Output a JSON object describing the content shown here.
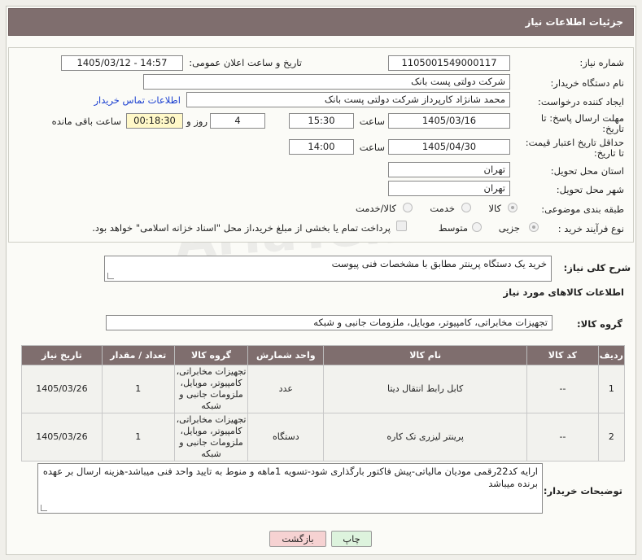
{
  "header": {
    "title": "جزئیات اطلاعات نیاز"
  },
  "form": {
    "need_number": {
      "label": "شماره نیاز:",
      "value": "1105001549000117"
    },
    "announce_datetime": {
      "label": "تاریخ و ساعت اعلان عمومی:",
      "value": "1405/03/12 - 14:57"
    },
    "buyer_org": {
      "label": "نام دستگاه خریدار:",
      "value": "شرکت دولتی پست بانک"
    },
    "requester": {
      "label": "ایجاد کننده درخواست:",
      "value": "محمد شانژاد کارپرداز شرکت دولتی پست بانک",
      "contact_link": "اطلاعات تماس خریدار"
    },
    "reply_deadline": {
      "label_line1": "مهلت ارسال پاسخ: تا",
      "label_line2": "تاریخ:",
      "date": "1405/03/16",
      "time_label": "ساعت",
      "time": "15:30",
      "days": "4",
      "days_label": "روز و",
      "remaining": "00:18:30",
      "remaining_label": "ساعت باقی مانده"
    },
    "price_validity": {
      "label_line1": "حداقل تاریخ اعتبار قیمت:",
      "label_line2": "تا تاریخ:",
      "date": "1405/04/30",
      "time_label": "ساعت",
      "time": "14:00"
    },
    "province": {
      "label": "استان محل تحویل:",
      "value": "تهران"
    },
    "city": {
      "label": "شهر محل تحویل:",
      "value": "تهران"
    },
    "category": {
      "label": "طبقه بندی موضوعی:",
      "options": [
        "کالا",
        "خدمت",
        "کالا/خدمت"
      ],
      "selected": "کالا"
    },
    "purchase_type": {
      "label": "نوع فرآیند خرید :",
      "options": [
        "جزیی",
        "متوسط"
      ],
      "selected": "جزیی",
      "payment_note": "پرداخت تمام یا بخشی از مبلغ خرید،از محل \"اسناد خزانه اسلامی\" خواهد بود."
    }
  },
  "summary": {
    "label": "شرح کلی نیاز:",
    "value": "خرید یک دستگاه پرینتر مطابق با مشخصات فنی پیوست"
  },
  "goods_section": {
    "title": "اطلاعات کالاهای مورد نیاز"
  },
  "goods_group": {
    "label": "گروه کالا:",
    "value": "تجهیزات مخابراتی، کامپیوتر، موبایل، ملزومات جانبی و شبکه"
  },
  "table": {
    "headers": [
      "ردیف",
      "کد کالا",
      "نام کالا",
      "واحد شمارش",
      "گروه کالا",
      "تعداد / مقدار",
      "تاریخ نیاز"
    ],
    "rows": [
      {
        "row": "1",
        "code": "--",
        "name": "کابل رابط انتقال دیتا",
        "unit": "عدد",
        "group": "تجهیزات مخابراتی، کامپیوتر، موبایل، ملزومات جانبی و شبکه",
        "qty": "1",
        "date": "1405/03/26"
      },
      {
        "row": "2",
        "code": "--",
        "name": "پرینتر لیزری تک کاره",
        "unit": "دستگاه",
        "group": "تجهیزات مخابراتی، کامپیوتر، موبایل، ملزومات جانبی و شبکه",
        "qty": "1",
        "date": "1405/03/26"
      }
    ]
  },
  "buyer_notes": {
    "label": "توضیحات خریدار:",
    "value": "ارایه کد22رقمی مودیان مالیاتی-پیش فاکتور بارگذاری شود-تسویه 1ماهه و منوط به تایید واحد فنی میباشد-هزینه ارسال بر عهده برنده میباشد"
  },
  "buttons": {
    "print": "چاپ",
    "back": "بازگشت"
  },
  "watermark": "AriaTender.net",
  "colors": {
    "header_bg": "#7f6e6e",
    "remaining_bg": "#fff8c8",
    "link": "#1a3fd0",
    "back_button": "#f6d2d2",
    "print_button": "#ddf3dd"
  }
}
